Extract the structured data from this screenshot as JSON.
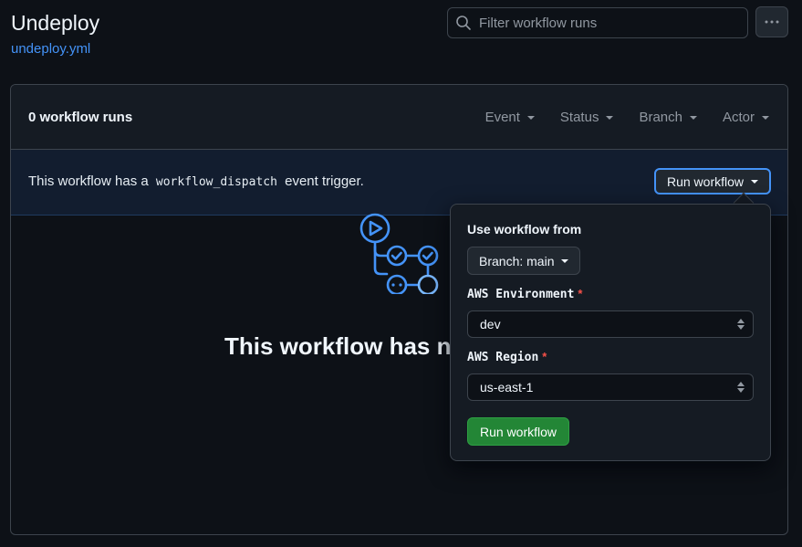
{
  "header": {
    "title": "Undeploy",
    "file_link": "undeploy.yml",
    "search_placeholder": "Filter workflow runs"
  },
  "runs": {
    "count_label": "0 workflow runs",
    "filters": [
      "Event",
      "Status",
      "Branch",
      "Actor"
    ]
  },
  "dispatch": {
    "text_before": "This workflow has a",
    "code": "workflow_dispatch",
    "text_after": "event trigger.",
    "button_label": "Run workflow"
  },
  "empty_state": {
    "text": "This workflow has n"
  },
  "popover": {
    "heading": "Use workflow from",
    "branch_button": "Branch: main",
    "fields": [
      {
        "label": "AWS Environment",
        "required_mark": "*",
        "value": "dev"
      },
      {
        "label": "AWS Region",
        "required_mark": "*",
        "value": "us-east-1"
      }
    ],
    "submit_label": "Run workflow"
  },
  "colors": {
    "background": "#0d1117",
    "accent": "#4493f8",
    "success": "#238636",
    "danger": "#f85149"
  }
}
